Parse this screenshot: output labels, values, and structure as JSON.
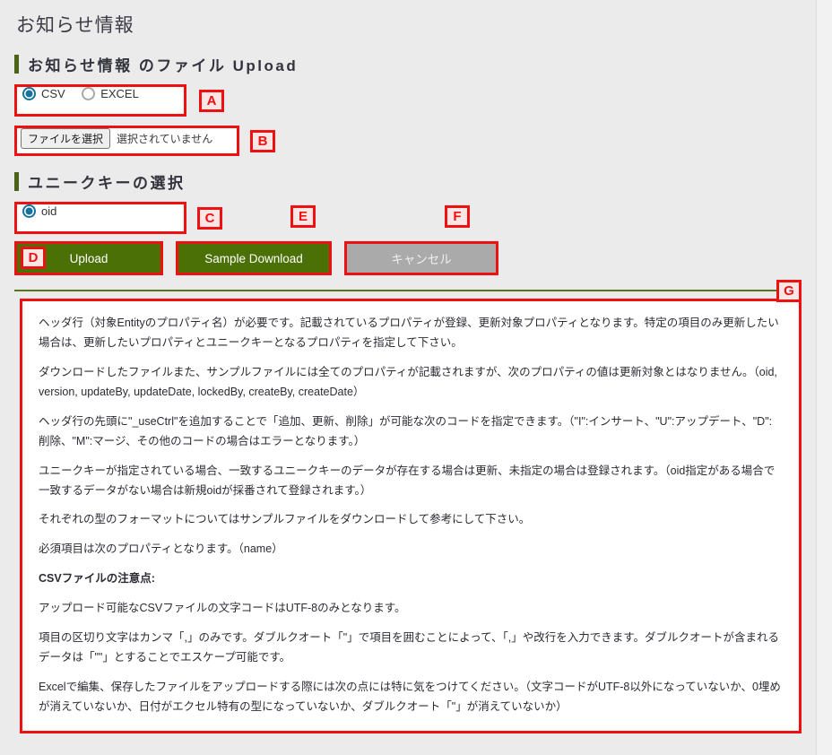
{
  "page": {
    "title": "お知らせ情報"
  },
  "upload_section": {
    "heading": "お知らせ情報 のファイル Upload",
    "format_options": [
      {
        "label": "CSV",
        "checked": true
      },
      {
        "label": "EXCEL",
        "checked": false
      }
    ],
    "file_input": {
      "button_label": "ファイルを選択",
      "status_text": "選択されていません"
    }
  },
  "uniquekey_section": {
    "heading": "ユニークキーの選択",
    "options": [
      {
        "label": "oid",
        "checked": true
      }
    ]
  },
  "buttons": {
    "upload": "Upload",
    "sample_download": "Sample Download",
    "cancel": "キャンセル"
  },
  "annotations": {
    "a": "A",
    "b": "B",
    "c": "C",
    "d": "D",
    "e": "E",
    "f": "F",
    "g": "G"
  },
  "colors": {
    "accent_green": "#4b7006",
    "heading_bar": "#4a6317",
    "divider": "#5a7419",
    "annotation_red": "#ee1111",
    "annotation_badge_bg": "#fbe6e6",
    "radio_blue": "#17729c",
    "disabled_gray": "#aaaaaa",
    "page_bg": "#ebebeb"
  },
  "notes": [
    {
      "bold": false,
      "text": "ヘッダ行（対象Entityのプロパティ名）が必要です。記載されているプロパティが登録、更新対象プロパティとなります。特定の項目のみ更新したい場合は、更新したいプロパティとユニークキーとなるプロパティを指定して下さい。"
    },
    {
      "bold": false,
      "text": "ダウンロードしたファイルまた、サンプルファイルには全てのプロパティが記載されますが、次のプロパティの値は更新対象とはなりません。（oid, version, updateBy, updateDate, lockedBy, createBy, createDate）"
    },
    {
      "bold": false,
      "text": "ヘッダ行の先頭に\"_useCtrl\"を追加することで「追加、更新、削除」が可能な次のコードを指定できます。（\"I\":インサート、\"U\":アップデート、\"D\":削除、\"M\":マージ、その他のコードの場合はエラーとなります。）"
    },
    {
      "bold": false,
      "text": "ユニークキーが指定されている場合、一致するユニークキーのデータが存在する場合は更新、未指定の場合は登録されます。（oid指定がある場合で一致するデータがない場合は新規oidが採番されて登録されます。）"
    },
    {
      "bold": false,
      "text": "それぞれの型のフォーマットについてはサンプルファイルをダウンロードして参考にして下さい。"
    },
    {
      "bold": false,
      "text": "必須項目は次のプロパティとなります。（name）"
    },
    {
      "bold": true,
      "text": "CSVファイルの注意点:"
    },
    {
      "bold": false,
      "text": "アップロード可能なCSVファイルの文字コードはUTF-8のみとなります。"
    },
    {
      "bold": false,
      "text": "項目の区切り文字はカンマ「,」のみです。ダブルクオート「\"」で項目を囲むことによって、「,」や改行を入力できます。ダブルクオートが含まれるデータは「\"\"」とすることでエスケープ可能です。"
    },
    {
      "bold": false,
      "text": "Excelで編集、保存したファイルをアップロードする際には次の点には特に気をつけてください。（文字コードがUTF-8以外になっていないか、0埋めが消えていないか、日付がエクセル特有の型になっていないか、ダブルクオート「\"」が消えていないか）"
    }
  ]
}
